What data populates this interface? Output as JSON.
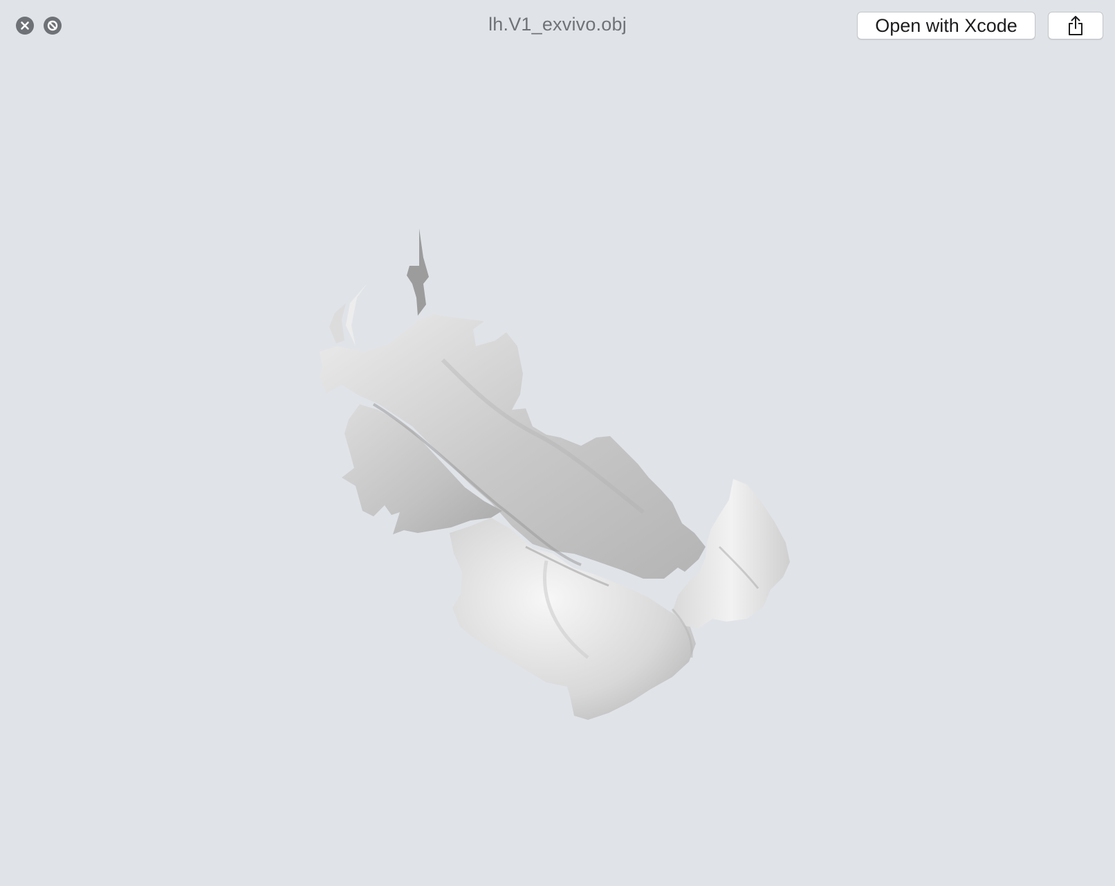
{
  "window": {
    "title": "lh.V1_exvivo.obj",
    "background_color": "#e0e3e8"
  },
  "controls": {
    "close_icon": "close-icon",
    "fullscreen_icon": "fullscreen-icon"
  },
  "toolbar": {
    "open_with_label": "Open with Xcode",
    "share_icon": "share-icon"
  },
  "preview": {
    "content": "3d-mesh-render",
    "mesh_color": "#d6d6d6"
  }
}
